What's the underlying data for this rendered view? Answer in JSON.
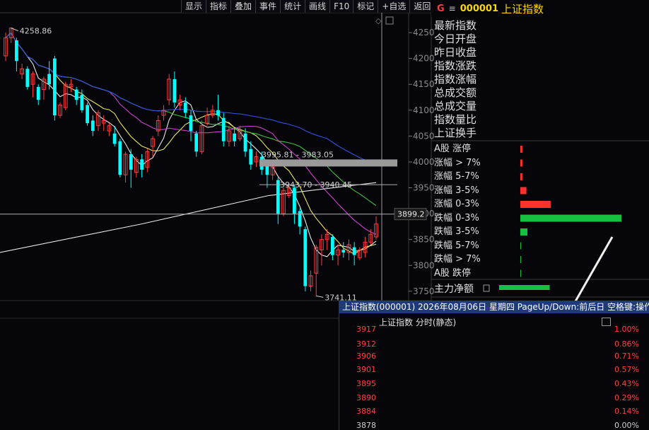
{
  "toolbar": [
    "显示",
    "指标",
    "叠加",
    "事件",
    "统计",
    "画线",
    "F10",
    "标记",
    "+自选",
    "返回"
  ],
  "header": {
    "marker": "G",
    "menu": "≡",
    "code": "000001",
    "name": "上证指数"
  },
  "stats": [
    "最新指数",
    "今日开盘",
    "昨日收盘",
    "指数涨跌",
    "指数涨幅",
    "总成交额",
    "总成交量",
    "指数量比",
    "上证换手"
  ],
  "breakdown": [
    {
      "label": "A股 涨停",
      "value": 0.02,
      "color": "#ff3030"
    },
    {
      "label": "涨幅 > 7%",
      "value": 0.02,
      "color": "#ff3030"
    },
    {
      "label": "涨幅 5-7%",
      "value": 0.02,
      "color": "#ff3030"
    },
    {
      "label": "涨幅 3-5%",
      "value": 0.06,
      "color": "#ff3030"
    },
    {
      "label": "涨幅 0-3%",
      "value": 0.3,
      "color": "#ff3030"
    },
    {
      "label": "跌幅 0-3%",
      "value": 1.0,
      "color": "#18c040"
    },
    {
      "label": "跌幅 3-5%",
      "value": 0.07,
      "color": "#18c040"
    },
    {
      "label": "跌幅 5-7%",
      "value": 0.005,
      "color": "#18c040"
    },
    {
      "label": "跌幅 > 7%",
      "value": 0.005,
      "color": "#18c040"
    },
    {
      "label": "A股 跌停",
      "value": 0.005,
      "color": "#18c040"
    }
  ],
  "zhuli": {
    "label": "主力净额",
    "value": 0.65,
    "color": "#18c040"
  },
  "chart_data": {
    "type": "candlestick",
    "yticks": [
      4250,
      4200,
      4150,
      4100,
      4050,
      4000,
      3950,
      3900,
      3850,
      3800,
      3750
    ],
    "ylim": [
      3732,
      4272
    ],
    "annotations": {
      "high_label": "4258.86",
      "low_label": "3741.11",
      "range1": "3995.81 - 3983.05",
      "range2": "3943.70 - 3940.45",
      "current": "3899.2",
      "current_value": 3899.2,
      "ref1": 3998,
      "ref2": 3956
    },
    "candles": [
      [
        4205,
        4240,
        4250,
        4195
      ],
      [
        4240,
        4258.86,
        4259,
        4230
      ],
      [
        4235,
        4195,
        4240,
        4175
      ],
      [
        4170,
        4180,
        4190,
        4160
      ],
      [
        4180,
        4145,
        4185,
        4140
      ],
      [
        4150,
        4170,
        4175,
        4125
      ],
      [
        4145,
        4120,
        4150,
        4110
      ],
      [
        4140,
        4160,
        4165,
        4120
      ],
      [
        4170,
        4150,
        4195,
        4140
      ],
      [
        4200,
        4090,
        4205,
        4080
      ],
      [
        4090,
        4110,
        4115,
        4085
      ],
      [
        4105,
        4150,
        4155,
        4100
      ],
      [
        4145,
        4150,
        4160,
        4135
      ],
      [
        4140,
        4120,
        4145,
        4110
      ],
      [
        4130,
        4100,
        4140,
        4095
      ],
      [
        4110,
        4075,
        4115,
        4070
      ],
      [
        4080,
        4060,
        4090,
        4050
      ],
      [
        4070,
        4095,
        4100,
        4060
      ],
      [
        4075,
        4080,
        4090,
        4060
      ],
      [
        4060,
        4070,
        4075,
        4050
      ],
      [
        4055,
        4035,
        4070,
        4030
      ],
      [
        4040,
        3975,
        4045,
        3970
      ],
      [
        3975,
        4015,
        4020,
        3960
      ],
      [
        4015,
        3985,
        4025,
        3950
      ],
      [
        3980,
        4005,
        4010,
        3970
      ],
      [
        4005,
        3985,
        4015,
        3970
      ],
      [
        3990,
        4020,
        4025,
        3980
      ],
      [
        4030,
        4045,
        4050,
        4010
      ],
      [
        4060,
        4080,
        4090,
        4050
      ],
      [
        4090,
        4100,
        4110,
        4080
      ],
      [
        4120,
        4160,
        4170,
        4110
      ],
      [
        4160,
        4115,
        4175,
        4105
      ],
      [
        4110,
        4120,
        4130,
        4100
      ],
      [
        4115,
        4095,
        4125,
        4085
      ],
      [
        4090,
        4060,
        4100,
        4040
      ],
      [
        4055,
        4020,
        4060,
        4010
      ],
      [
        4020,
        4070,
        4080,
        4015
      ],
      [
        4075,
        4090,
        4105,
        4070
      ],
      [
        4090,
        4100,
        4110,
        4085
      ],
      [
        4100,
        4090,
        4130,
        4080
      ],
      [
        4085,
        4040,
        4095,
        4030
      ],
      [
        4040,
        4060,
        4070,
        4030
      ],
      [
        4055,
        4040,
        4065,
        4030
      ],
      [
        4045,
        4060,
        4070,
        4040
      ],
      [
        4055,
        4020,
        4065,
        4010
      ],
      [
        4025,
        3995,
        4040,
        3985
      ],
      [
        4000,
        4010,
        4020,
        3990
      ],
      [
        4010,
        3985,
        4020,
        3975
      ],
      [
        4000,
        3975,
        4005,
        3950
      ],
      [
        3975,
        3990,
        4000,
        3965
      ],
      [
        3965,
        3900,
        3970,
        3880
      ],
      [
        3900,
        3945,
        3950,
        3895
      ],
      [
        3935,
        3950,
        3960,
        3930
      ],
      [
        3950,
        3900,
        3955,
        3880
      ],
      [
        3905,
        3875,
        3910,
        3860
      ],
      [
        3870,
        3760,
        3875,
        3750
      ],
      [
        3760,
        3780,
        3790,
        3750
      ],
      [
        3785,
        3835,
        3840,
        3741.11
      ],
      [
        3830,
        3850,
        3860,
        3800
      ],
      [
        3850,
        3860,
        3870,
        3830
      ],
      [
        3855,
        3820,
        3860,
        3810
      ],
      [
        3820,
        3830,
        3840,
        3800
      ],
      [
        3830,
        3825,
        3845,
        3815
      ],
      [
        3825,
        3840,
        3850,
        3810
      ],
      [
        3835,
        3820,
        3845,
        3800
      ],
      [
        3815,
        3830,
        3835,
        3810
      ],
      [
        3825,
        3845,
        3855,
        3815
      ],
      [
        3845,
        3860,
        3870,
        3840
      ],
      [
        3855,
        3880,
        3895,
        3850
      ]
    ],
    "intraday": {
      "title": "上证指数(000001) 2026年08月06日 星期四 PageUp/Down:前后日 空格键:操作",
      "subtitle": "上证指数 分时(静态)",
      "left_ticks": [
        "3917",
        "3912",
        "3906",
        "3901",
        "3895",
        "3890",
        "3884",
        "3878"
      ],
      "right_ticks": [
        "1.00%",
        "0.86%",
        "0.71%",
        "0.57%",
        "0.43%",
        "0.29%",
        "0.14%",
        "0.00%"
      ]
    }
  }
}
